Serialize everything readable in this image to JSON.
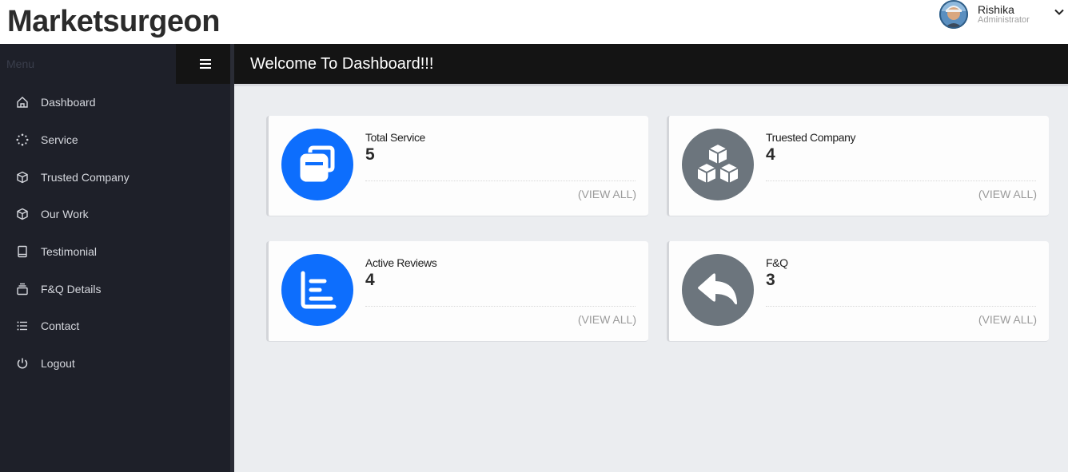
{
  "brand": "Marketsurgeon",
  "user": {
    "name": "Rishika",
    "role": "Administrator"
  },
  "sidebar": {
    "menu_label": "Menu",
    "items": [
      {
        "label": "Dashboard",
        "icon": "home-icon"
      },
      {
        "label": "Service",
        "icon": "loader-icon"
      },
      {
        "label": "Trusted Company",
        "icon": "box-icon"
      },
      {
        "label": "Our Work",
        "icon": "box-icon"
      },
      {
        "label": "Testimonial",
        "icon": "book-icon"
      },
      {
        "label": "F&Q Details",
        "icon": "archive-icon"
      },
      {
        "label": "Contact",
        "icon": "list-icon"
      },
      {
        "label": "Logout",
        "icon": "power-icon"
      }
    ]
  },
  "header": {
    "title": "Welcome To Dashboard!!!"
  },
  "cards": [
    {
      "label": "Total Service",
      "count": "5",
      "link": "(VIEW ALL)",
      "icon": "copy-icon",
      "color": "#0d6efd"
    },
    {
      "label": "Truested Company",
      "count": "4",
      "link": "(VIEW ALL)",
      "icon": "boxes-icon",
      "color": "#6c757d"
    },
    {
      "label": "Active Reviews",
      "count": "4",
      "link": "(VIEW ALL)",
      "icon": "bar-chart-icon",
      "color": "#0d6efd"
    },
    {
      "label": "F&Q",
      "count": "3",
      "link": "(VIEW ALL)",
      "icon": "reply-icon",
      "color": "#6c757d"
    }
  ]
}
